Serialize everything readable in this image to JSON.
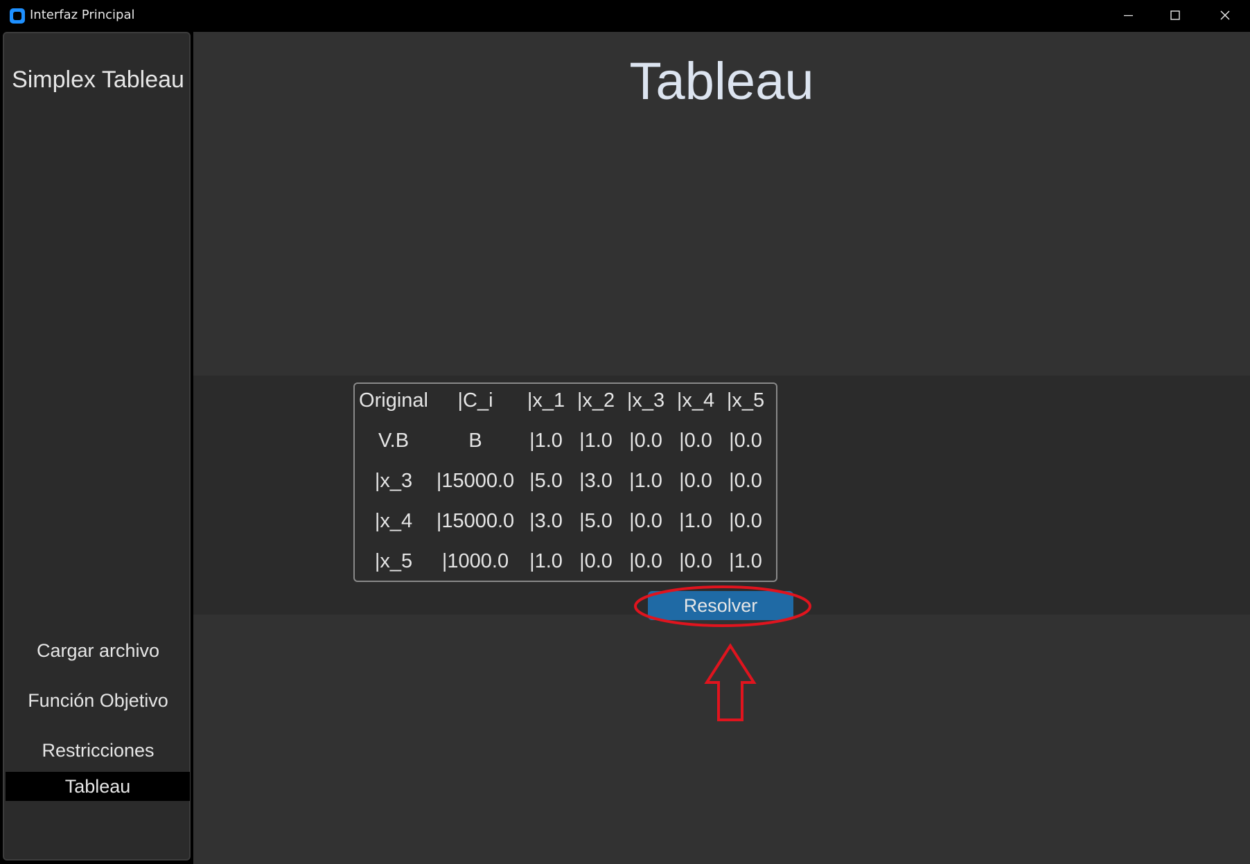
{
  "window": {
    "title": "Interfaz Principal"
  },
  "sidebar": {
    "title": "Simplex Tableau",
    "items": [
      {
        "label": "Cargar archivo"
      },
      {
        "label": "Función Objetivo"
      },
      {
        "label": "Restricciones"
      },
      {
        "label": "Tableau",
        "active": true
      }
    ]
  },
  "main": {
    "title": "Tableau",
    "tableau": {
      "header": [
        "Original",
        "|C_i",
        "|x_1",
        "|x_2",
        "|x_3",
        "|x_4",
        "|x_5"
      ],
      "rows": [
        [
          "V.B",
          "B",
          "|1.0",
          "|1.0",
          "|0.0",
          "|0.0",
          "|0.0"
        ],
        [
          "|x_3",
          "|15000.0",
          "|5.0",
          "|3.0",
          "|1.0",
          "|0.0",
          "|0.0"
        ],
        [
          "|x_4",
          "|15000.0",
          "|3.0",
          "|5.0",
          "|0.0",
          "|1.0",
          "|0.0"
        ],
        [
          "|x_5",
          "|1000.0",
          "|1.0",
          "|0.0",
          "|0.0",
          "|0.0",
          "|1.0"
        ]
      ]
    },
    "resolve_label": "Resolver"
  },
  "colors": {
    "accent": "#1f6aa5",
    "annotation": "#e0141e",
    "sidebar_bg": "#2b2b2b",
    "main_bg": "#323232"
  }
}
